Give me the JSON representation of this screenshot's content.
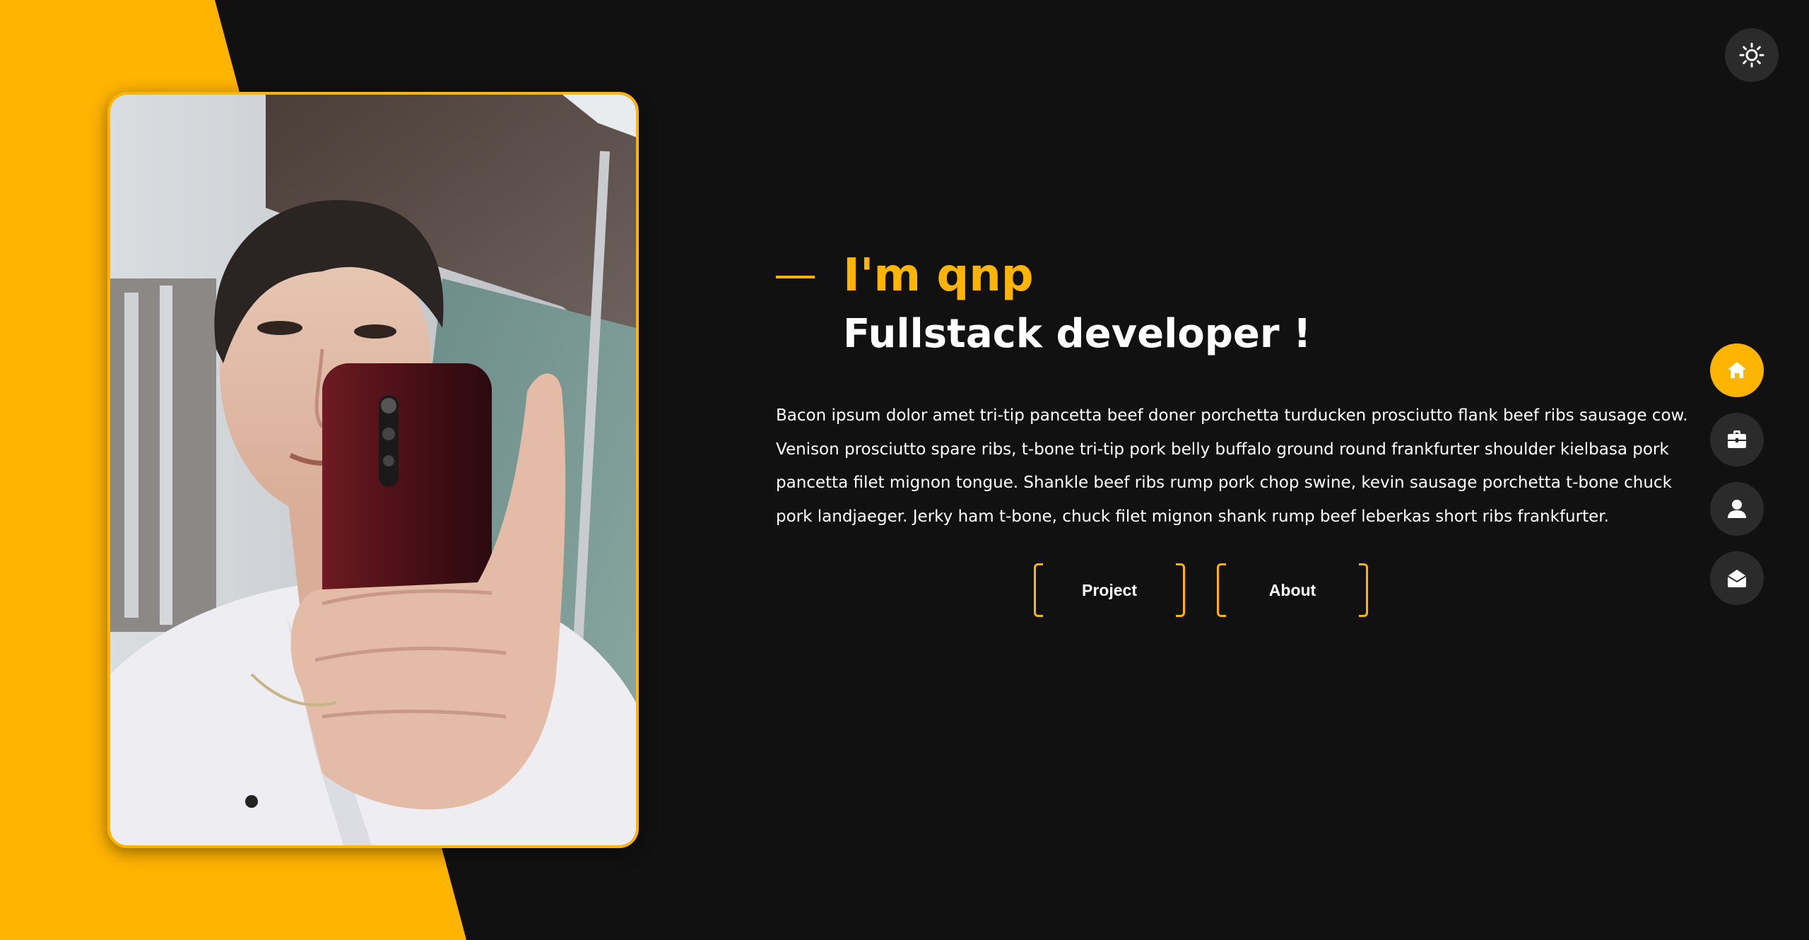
{
  "theme": {
    "accent": "#ffb400",
    "background": "#111111",
    "button_bg": "#2b2b2b",
    "toggle_icon": "sun-icon"
  },
  "profile": {
    "photo": "portrait-photo"
  },
  "hero": {
    "name": "I'm qnp",
    "role": "Fullstack developer !",
    "description_lines": [
      "Bacon ipsum dolor amet tri-tip pancetta beef doner porchetta turducken prosciutto flank beef ribs sausage cow.",
      "Venison prosciutto spare ribs, t-bone tri-tip pork belly buffalo ground round frankfurter shoulder kielbasa pork",
      "pancetta filet mignon tongue. Shankle beef ribs rump pork chop swine, kevin sausage porchetta t-bone chuck",
      "pork landjaeger. Jerky ham t-bone, chuck filet mignon shank rump beef leberkas short ribs frankfurter."
    ]
  },
  "actions": {
    "project_label": "Project",
    "about_label": "About"
  },
  "nav": {
    "items": [
      {
        "icon": "home-icon",
        "active": true
      },
      {
        "icon": "briefcase-icon",
        "active": false
      },
      {
        "icon": "user-icon",
        "active": false
      },
      {
        "icon": "envelope-open-icon",
        "active": false
      }
    ]
  }
}
